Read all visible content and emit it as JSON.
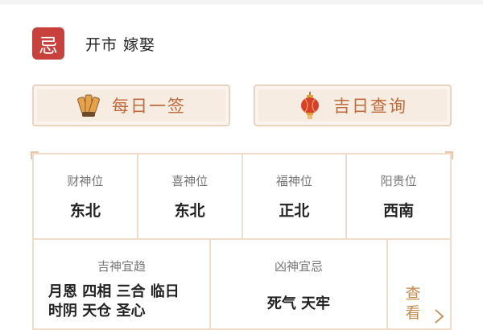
{
  "ji": {
    "badge": "忌",
    "items": "开市  嫁娶"
  },
  "buttons": {
    "daily": "每日一签",
    "lucky": "吉日查询"
  },
  "positions": [
    {
      "label": "财神位",
      "value": "东北"
    },
    {
      "label": "喜神位",
      "value": "东北"
    },
    {
      "label": "福神位",
      "value": "正北"
    },
    {
      "label": "阳贵位",
      "value": "西南"
    }
  ],
  "jishen": {
    "title": "吉神宜趋",
    "line1": "月恩 四相 三合 临日",
    "line2": "时阴 天仓 圣心"
  },
  "xiongsha": {
    "title": "凶神宜忌",
    "value": "死气 天牢"
  },
  "more": {
    "label": "查看"
  },
  "colors": {
    "accent": "#c8413d",
    "gold": "#bf6a3a",
    "border": "#f0dcc8"
  }
}
